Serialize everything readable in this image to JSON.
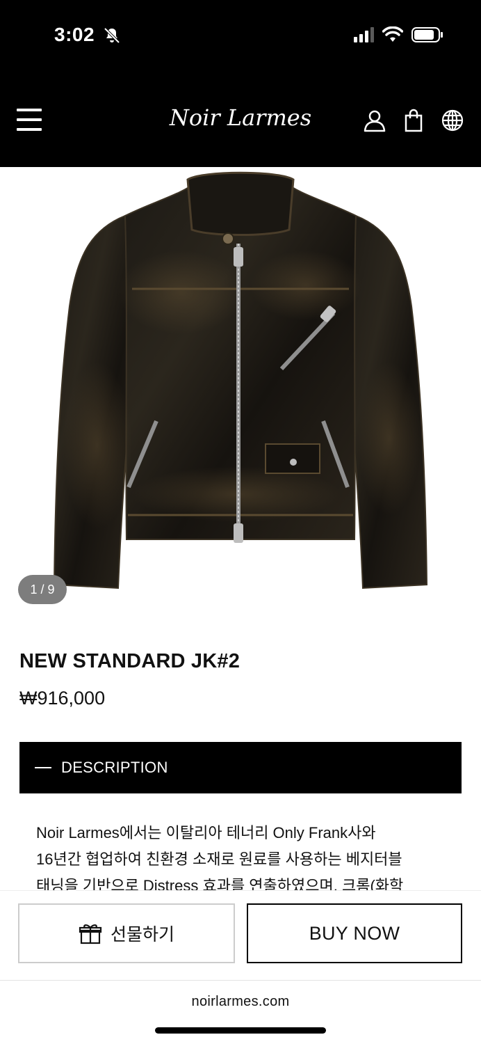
{
  "status_bar": {
    "time": "3:02",
    "silent_icon": "bell-slash-icon",
    "signal_bars_active": 3,
    "battery_icon": "battery-icon"
  },
  "header": {
    "brand": "Noir Larmes",
    "menu_icon": "hamburger-menu-icon",
    "icons": [
      "user-icon",
      "shopping-bag-icon",
      "globe-icon"
    ]
  },
  "gallery": {
    "counter": "1 / 9",
    "image": "black-leather-jacket"
  },
  "product": {
    "title": "NEW STANDARD JK#2",
    "price": "₩916,000"
  },
  "accordion": {
    "label": "DESCRIPTION",
    "expanded": true
  },
  "description": {
    "line1": "Noir Larmes에서는 이탈리아 테너리 Only Frank사와",
    "line2": "16년간 협업하여 친환경 소재로 원료를 사용하는 베지터블",
    "line3": "태닝을 기반으로 Distress 효과를 연출하였으며, 크롬(화학"
  },
  "actions": {
    "gift_label": "선물하기",
    "buy_label": "BUY NOW"
  },
  "footer": {
    "domain": "noirlarmes.com"
  },
  "colors": {
    "header_bg": "#000000",
    "accent": "#000000",
    "counter_bg": "#7d7d7d"
  }
}
